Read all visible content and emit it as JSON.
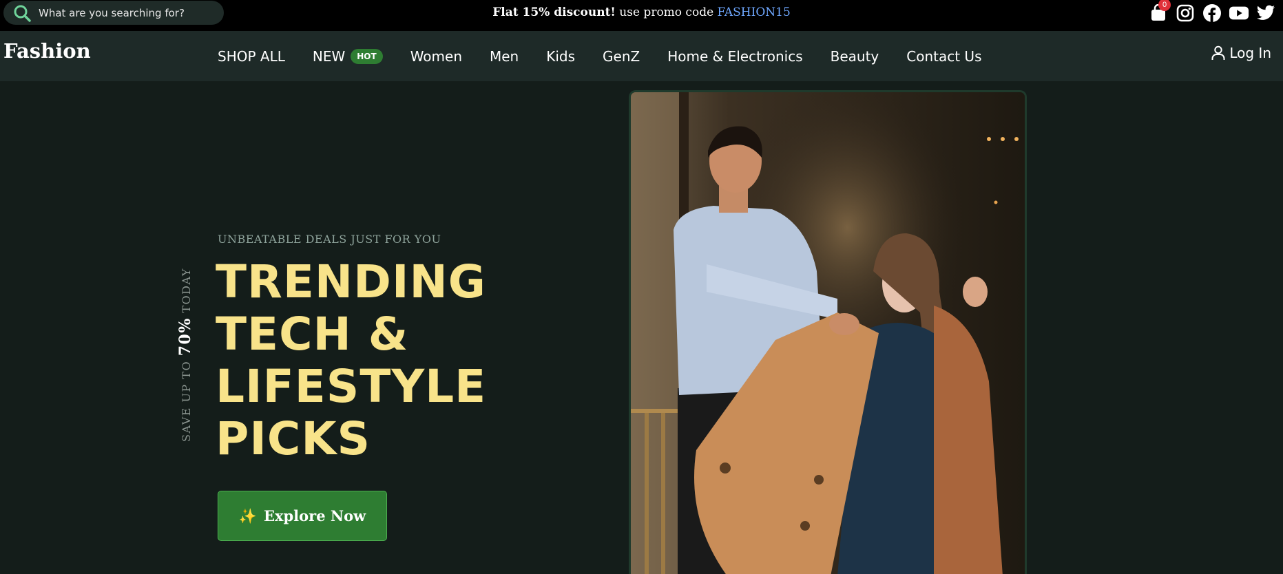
{
  "topbar": {
    "search_placeholder": "What are you searching for?",
    "promo_bold": "Flat 15% discount!",
    "promo_text": " use promo code ",
    "promo_code": "FASHION15",
    "cart_count": "0",
    "icons": [
      "shopping-bag-icon",
      "instagram-icon",
      "facebook-icon",
      "youtube-icon",
      "twitter-icon"
    ]
  },
  "nav": {
    "logo": "Fashion",
    "items": [
      {
        "label": "SHOP ALL"
      },
      {
        "label": "NEW",
        "badge": "HOT"
      },
      {
        "label": "Women"
      },
      {
        "label": "Men"
      },
      {
        "label": "Kids"
      },
      {
        "label": "GenZ"
      },
      {
        "label": "Home & Electronics"
      },
      {
        "label": "Beauty"
      },
      {
        "label": "Contact Us"
      }
    ],
    "login": "Log In"
  },
  "hero": {
    "vertical_pre": "SAVE UP TO ",
    "vertical_pct": "70%",
    "vertical_post": " TODAY",
    "eyebrow": "UNBEATABLE DEALS JUST FOR YOU",
    "headline": [
      "TRENDING",
      "TECH &",
      "LIFESTYLE",
      "PICKS"
    ],
    "cta_icon": "✨",
    "cta_label": "Explore Now"
  },
  "colors": {
    "background": "#141d1a",
    "nav": "#1e2a28",
    "accent_green": "#2e7d32",
    "headline_yellow": "#f8e38a",
    "promo_code_blue": "#6fa8ff",
    "badge_red": "#e0303a"
  }
}
